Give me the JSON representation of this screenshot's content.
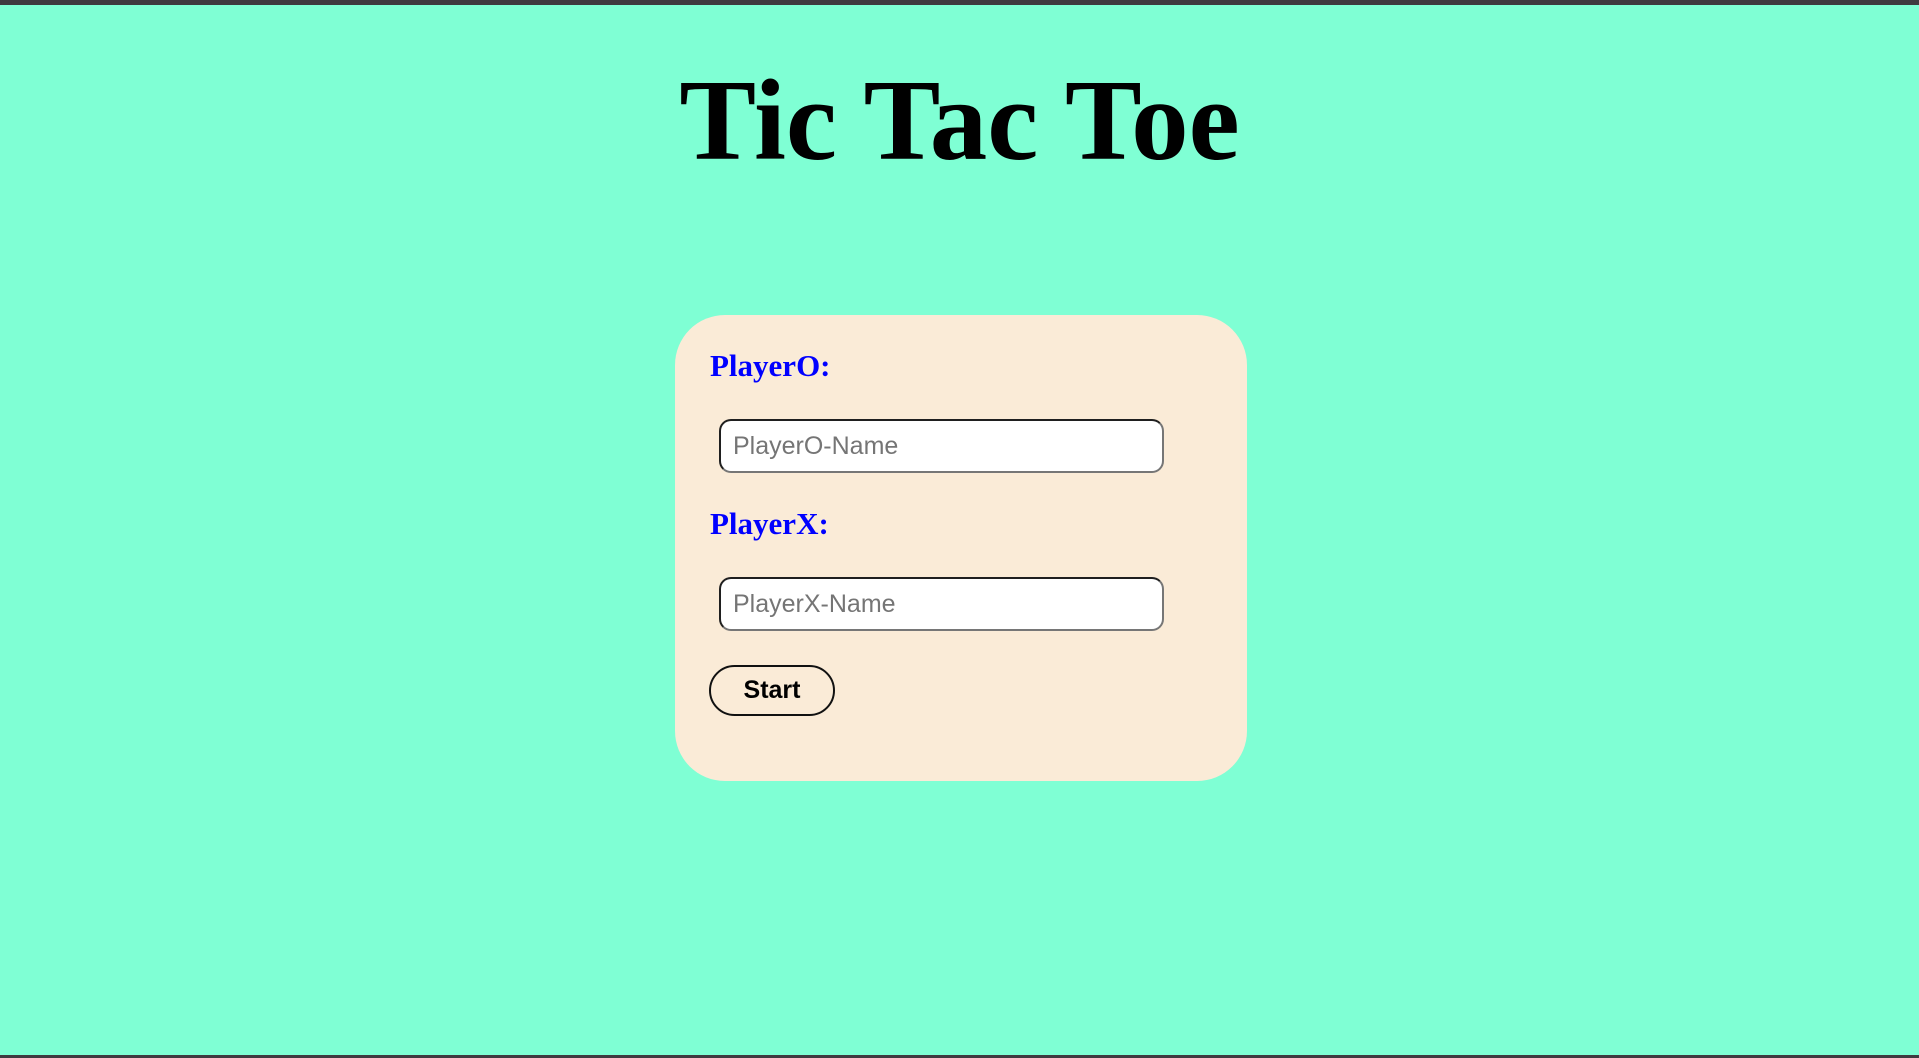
{
  "page": {
    "title": "Tic Tac Toe"
  },
  "form": {
    "player_o": {
      "label": "PlayerO:",
      "value": "",
      "placeholder": "PlayerO-Name"
    },
    "player_x": {
      "label": "PlayerX:",
      "value": "",
      "placeholder": "PlayerX-Name"
    },
    "start_label": "Start"
  },
  "colors": {
    "background": "#7fffd4",
    "card": "#faebd7",
    "label": "#0000ff",
    "title": "#000000"
  }
}
